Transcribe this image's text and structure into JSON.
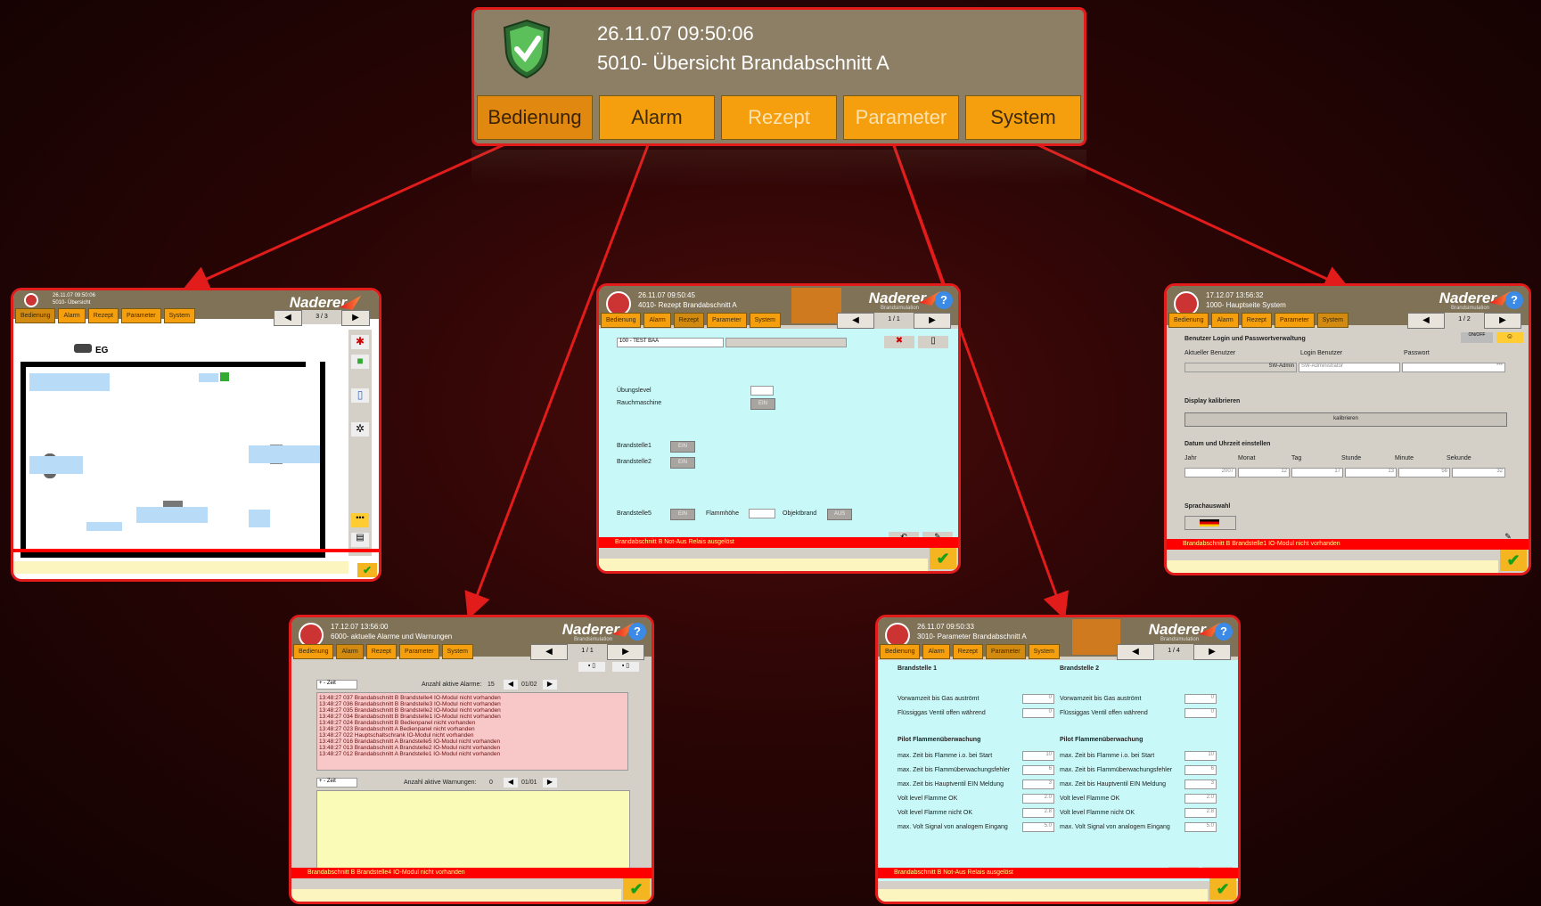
{
  "main": {
    "datetime": "26.11.07 09:50:06",
    "title": "5010- Übersicht Brandabschnitt A",
    "tabs": [
      "Bedienung",
      "Alarm",
      "Rezept",
      "Parameter",
      "System"
    ]
  },
  "colors": {
    "accent": "#e21b1b",
    "tab": "#f59f0e",
    "header": "#8c7f66",
    "panel": "#c8f8f8"
  },
  "brand": {
    "name": "Naderer",
    "sub": "Brandsimulation"
  },
  "screen_overview": {
    "datetime": "26.11.07 09:50:06",
    "title": "5010- Übersicht",
    "floor": "EG",
    "page": "3 / 3",
    "tabs": [
      "Bedienung",
      "Alarm",
      "Rezept",
      "Parameter",
      "System"
    ]
  },
  "screen_rezept": {
    "datetime": "26.11.07 09:50:45",
    "title": "4010- Rezept Brandabschnitt A",
    "page": "1 / 1",
    "recipe": "100 - TEST BAA",
    "labels": [
      "Übungslevel",
      "Rauchmaschine",
      "Brandstelle1",
      "Brandstelle2",
      "Brandstelle5",
      "Flammhöhe",
      "Objektbrand"
    ],
    "on": "EIN",
    "off": "AUS",
    "alarm": "Brandabschnitt B Not-Aus Relais ausgelöst",
    "tabs": [
      "Bedienung",
      "Alarm",
      "Rezept",
      "Parameter",
      "System"
    ]
  },
  "screen_system": {
    "datetime": "17.12.07 13:56:32",
    "title": "1000- Hauptseite System",
    "page": "1 / 2",
    "sec_login": "Benutzer Login und Passwortverwaltung",
    "col_user": "Aktueller Benutzer",
    "col_login": "Login Benutzer",
    "col_pw": "Passwort",
    "user_val": "SW-Admin",
    "login_val": "SW-Administrator",
    "pw_val": "***",
    "sec_display": "Display kalibrieren",
    "btn_cal": "kalibrieren",
    "sec_date": "Datum und Uhrzeit einstellen",
    "date_cols": [
      "Jahr",
      "Monat",
      "Tag",
      "Stunde",
      "Minute",
      "Sekunde"
    ],
    "date_vals": [
      "2007",
      "12",
      "17",
      "13",
      "56",
      "32"
    ],
    "sec_lang": "Sprachauswahl",
    "alarm": "Brandabschnitt B Brandstelle1 IO-Modul nicht vorhanden",
    "tabs": [
      "Bedienung",
      "Alarm",
      "Rezept",
      "Parameter",
      "System"
    ]
  },
  "screen_alarm": {
    "datetime": "17.12.07 13:56:00",
    "title": "6000- aktuelle Alarme und Warnungen",
    "page": "1 / 1",
    "sort": "+ - Zeit",
    "active_alarms_label": "Anzahl aktive Alarme:",
    "active_alarms": "15",
    "alarm_page": "01/02",
    "active_warn_label": "Anzahl aktive Warnungen:",
    "active_warn": "0",
    "warn_page": "01/01",
    "rows": [
      "13:48:27  037  Brandabschnitt B Brandstelle4 IO-Modul nicht vorhanden",
      "13:48:27  036  Brandabschnitt B Brandstelle3 IO-Modul nicht vorhanden",
      "13:48:27  035  Brandabschnitt B Brandstelle2 IO-Modul nicht vorhanden",
      "13:48:27  034  Brandabschnitt B Brandstelle1 IO-Modul nicht vorhanden",
      "13:48:27  024  Brandabschnitt B Bedienpanel nicht vorhanden",
      "13:48:27  023  Brandabschnitt A Bedienpanel nicht vorhanden",
      "13:48:27  022  Hauptschaltschrank IO-Modul nicht vorhanden",
      "13:48:27  016  Brandabschnitt A Brandstelle5 IO-Modul nicht vorhanden",
      "13:48:27  013  Brandabschnitt A Brandstelle2 IO-Modul nicht vorhanden",
      "13:48:27  012  Brandabschnitt A Brandstelle1 IO-Modul nicht vorhanden"
    ],
    "alarm": "Brandabschnitt B Brandstelle4 IO-Modul nicht vorhanden",
    "tabs": [
      "Bedienung",
      "Alarm",
      "Rezept",
      "Parameter",
      "System"
    ]
  },
  "screen_param": {
    "datetime": "26.11.07 09:50:33",
    "title": "3010- Parameter Brandabschnitt A",
    "page": "1 / 4",
    "col1": "Brandstelle 1",
    "col2": "Brandstelle 2",
    "rows_a": [
      "Vorwarnzeit bis Gas auströmt",
      "Flüssiggas Ventil offen während"
    ],
    "sec_pilot": "Pilot Flammenüberwachung",
    "rows_b": [
      "max. Zeit bis Flamme i.o. bei Start",
      "max. Zeit bis Flammüberwachungsfehler",
      "max. Zeit bis Hauptventil EIN Meldung",
      "Volt level Flamme OK",
      "Volt level Flamme nicht OK",
      "max. Volt Signal von analogem Eingang"
    ],
    "vals_a": [
      "0",
      "0"
    ],
    "vals_b": [
      "10",
      "6",
      "3",
      "2.0",
      "2.8",
      "5.0"
    ],
    "alarm": "Brandabschnitt B Not-Aus Relais ausgelöst",
    "tabs": [
      "Bedienung",
      "Alarm",
      "Rezept",
      "Parameter",
      "System"
    ]
  }
}
